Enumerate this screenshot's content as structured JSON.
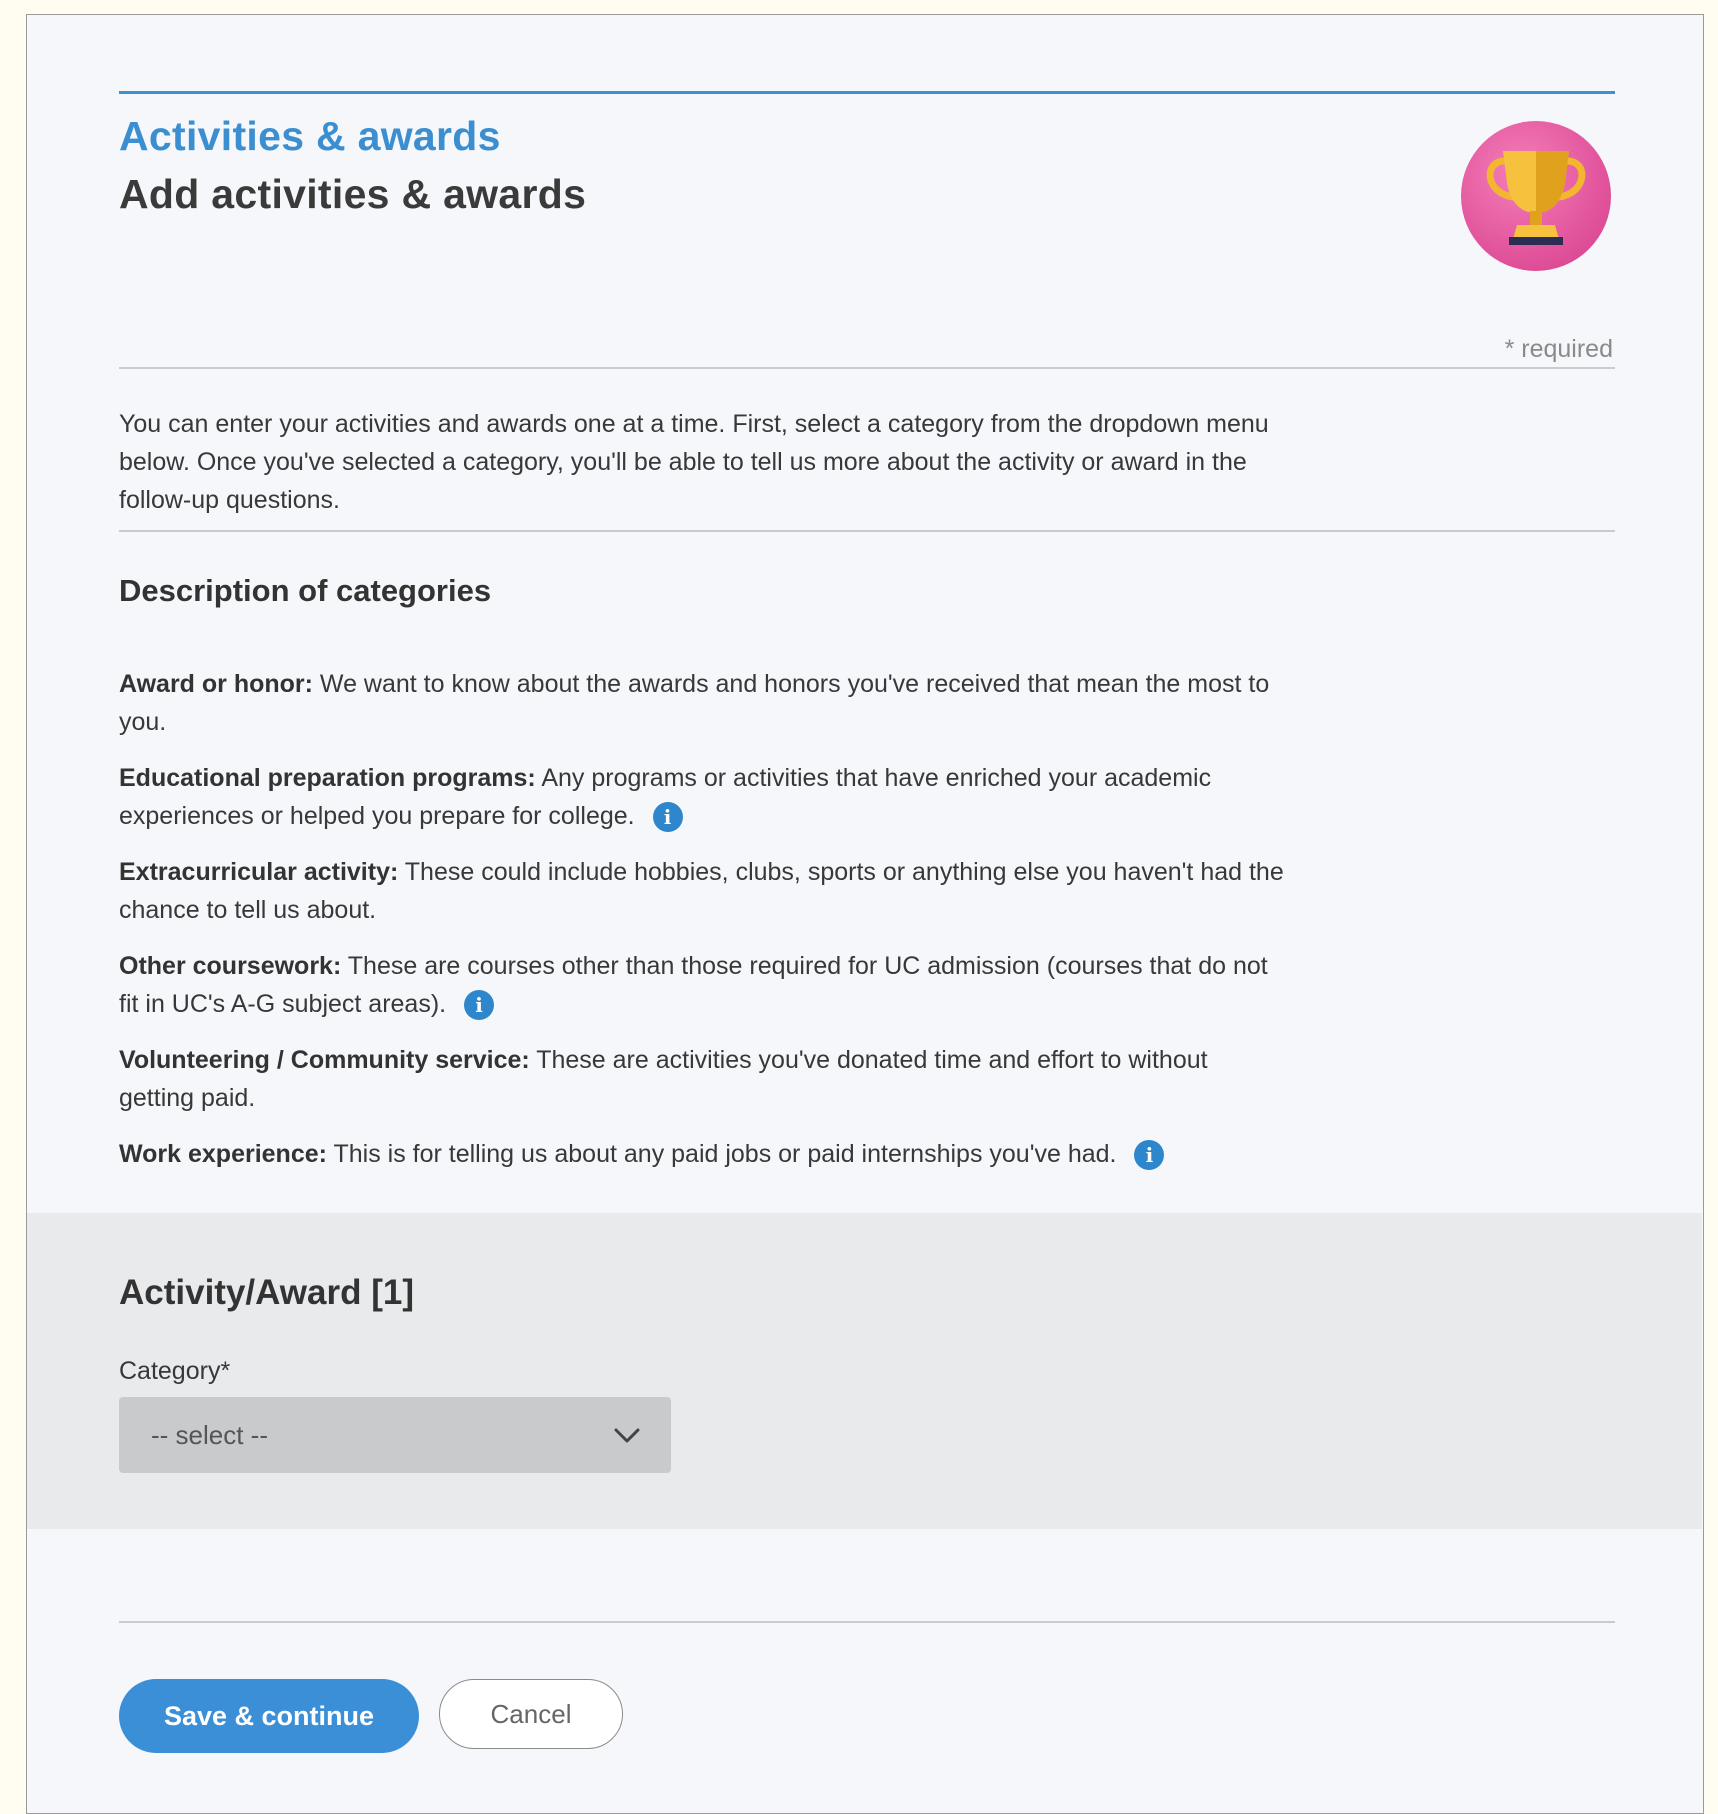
{
  "header": {
    "eyebrow": "Activities & awards",
    "title": "Add activities & awards",
    "icon": "trophy-icon",
    "required_note": "* required"
  },
  "intro": {
    "text": "You can enter your activities and awards one at a time. First, select a category from the dropdown menu below. Once you've selected a category, you'll be able to tell us more about the activity or award in the follow-up questions."
  },
  "descriptions": {
    "heading": "Description of categories",
    "items": [
      {
        "term": "Award or honor:",
        "text": " We want to know about the awards and honors you've received that mean the most to you.",
        "info": false
      },
      {
        "term": "Educational preparation programs:",
        "text": " Any programs or activities that have enriched your academic experiences or helped you prepare for college.",
        "info": true
      },
      {
        "term": "Extracurricular activity:",
        "text": " These could include hobbies, clubs, sports or anything else you haven't had the chance to tell us about.",
        "info": false
      },
      {
        "term": "Other coursework:",
        "text": " These are courses other than those required for UC admission (courses that do not fit in UC's A-G subject areas).",
        "info": true
      },
      {
        "term": "Volunteering / Community service:",
        "text": " These are activities you've donated time and effort to without getting paid.",
        "info": false
      },
      {
        "term": "Work experience:",
        "text": " This is for telling us about any paid jobs or paid internships you've had.",
        "info": true
      }
    ],
    "info_glyph": "i"
  },
  "activity": {
    "title": "Activity/Award [1]",
    "category_label": "Category*",
    "select_value": "-- select --"
  },
  "actions": {
    "save_label": "Save & continue",
    "cancel_label": "Cancel"
  },
  "colors": {
    "accent": "#3b8fd0",
    "panel": "#e9eaeb",
    "trophy_bg": "#e2559d"
  }
}
